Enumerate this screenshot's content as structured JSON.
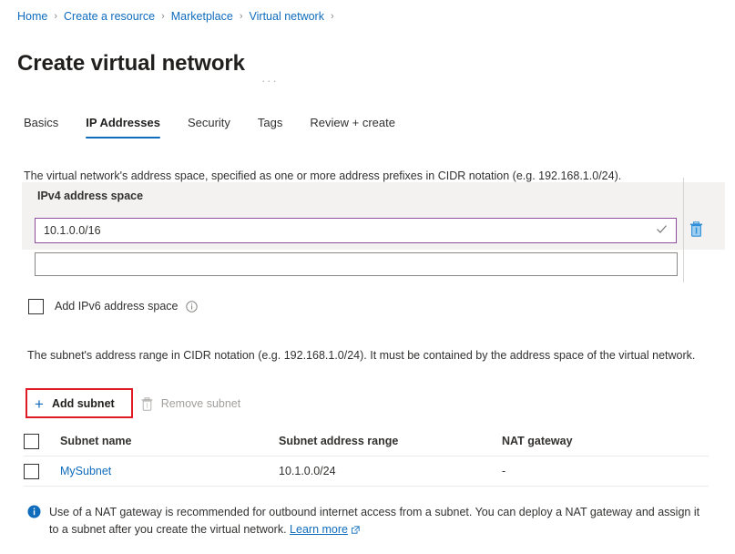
{
  "breadcrumb": {
    "separator": "›",
    "items": [
      {
        "label": "Home"
      },
      {
        "label": "Create a resource"
      },
      {
        "label": "Marketplace"
      },
      {
        "label": "Virtual network"
      }
    ]
  },
  "header": {
    "title": "Create virtual network",
    "more_menu": "···"
  },
  "tabs": [
    {
      "label": "Basics",
      "active": false
    },
    {
      "label": "IP Addresses",
      "active": true
    },
    {
      "label": "Security",
      "active": false
    },
    {
      "label": "Tags",
      "active": false
    },
    {
      "label": "Review + create",
      "active": false
    }
  ],
  "vnet": {
    "description": "The virtual network's address space, specified as one or more address prefixes in CIDR notation (e.g. 192.168.1.0/24).",
    "ipv4_label": "IPv4 address space",
    "ipv4_value": "10.1.0.0/16",
    "ipv4_placeholder": "",
    "ipv4_valid_icon": "check-icon",
    "delete_icon": "trash-icon",
    "ipv4_second_value": "",
    "ipv4_second_placeholder": ""
  },
  "ipv6": {
    "checkbox_label": "Add IPv6 address space",
    "checked": false,
    "info_icon": "info-icon"
  },
  "subnets": {
    "description": "The subnet's address range in CIDR notation (e.g. 192.168.1.0/24). It must be contained by the address space of the virtual network.",
    "add_label": "Add subnet",
    "add_icon": "plus-icon",
    "remove_label": "Remove subnet",
    "remove_icon": "trash-icon",
    "remove_disabled": true,
    "columns": [
      "Subnet name",
      "Subnet address range",
      "NAT gateway"
    ],
    "rows": [
      {
        "checked": false,
        "name": "MySubnet",
        "range": "10.1.0.0/24",
        "nat_gateway": "-"
      }
    ]
  },
  "info_banner": {
    "icon": "info-icon",
    "text": "Use of a NAT gateway is recommended for outbound internet access from a subnet. You can deploy a NAT gateway and assign it to a subnet after you create the virtual network. ",
    "link_label": "Learn more",
    "link_icon": "external-link-icon"
  },
  "colors": {
    "accent_blue": "#0f6cbd",
    "focus_purple": "#8e4d9e",
    "highlight_red": "#e01b24",
    "band_gray": "#f3f2f1",
    "disabled_gray": "#a19f9d",
    "text": "#323130"
  }
}
